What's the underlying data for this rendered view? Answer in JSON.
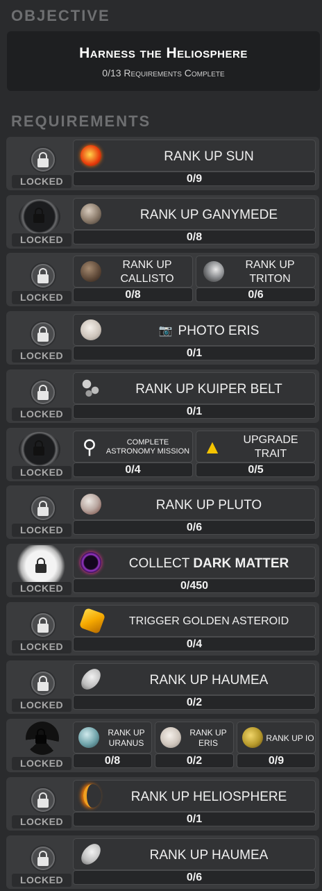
{
  "objective": {
    "section_title": "OBJECTIVE",
    "name": "Harness the Heliosphere",
    "progress": "0/13 Requirements Complete"
  },
  "requirements": {
    "section_title": "REQUIREMENTS",
    "locked_label": "LOCKED",
    "rows": [
      {
        "tasks": [
          {
            "label": "RANK UP SUN",
            "icon": "sun-icon",
            "progress": "0/9"
          }
        ]
      },
      {
        "tasks": [
          {
            "label": "RANK UP GANYMEDE",
            "icon": "ganymede-icon",
            "progress": "0/8"
          }
        ]
      },
      {
        "tasks": [
          {
            "label": "RANK UP CALLISTO",
            "icon": "callisto-icon",
            "progress": "0/8"
          },
          {
            "label": "RANK UP TRITON",
            "icon": "triton-icon",
            "progress": "0/6"
          }
        ]
      },
      {
        "tasks": [
          {
            "label": "PHOTO ERIS",
            "icon": "camera-icon",
            "progress": "0/1"
          }
        ]
      },
      {
        "tasks": [
          {
            "label": "RANK UP KUIPER BELT",
            "icon": "kuiper-belt-icon",
            "progress": "0/1"
          }
        ]
      },
      {
        "tasks": [
          {
            "label": "COMPLETE ASTRONOMY MISSION",
            "icon": "telescope-icon",
            "progress": "0/4"
          },
          {
            "label": "UPGRADE TRAIT",
            "icon": "trait-cards-icon",
            "progress": "0/5"
          }
        ]
      },
      {
        "tasks": [
          {
            "label": "RANK UP PLUTO",
            "icon": "pluto-icon",
            "progress": "0/6"
          }
        ]
      },
      {
        "tasks": [
          {
            "label_prefix": "COLLECT ",
            "label_strong": "DARK MATTER",
            "icon": "dark-matter-icon",
            "progress": "0/450"
          }
        ]
      },
      {
        "tasks": [
          {
            "label": "TRIGGER   GOLDEN ASTEROID",
            "icon": "golden-asteroid-icon",
            "progress": "0/4"
          }
        ]
      },
      {
        "tasks": [
          {
            "label": "RANK UP HAUMEA",
            "icon": "haumea-icon",
            "progress": "0/2"
          }
        ]
      },
      {
        "tasks": [
          {
            "label": "RANK UP URANUS",
            "icon": "uranus-icon",
            "progress": "0/8"
          },
          {
            "label": "RANK UP ERIS",
            "icon": "eris-icon",
            "progress": "0/2"
          },
          {
            "label": "RANK UP IO",
            "icon": "io-icon",
            "progress": "0/9"
          }
        ]
      },
      {
        "tasks": [
          {
            "label": "RANK UP HELIOSPHERE",
            "icon": "heliosphere-icon",
            "progress": "0/1"
          }
        ]
      },
      {
        "tasks": [
          {
            "label": "RANK UP HAUMEA",
            "icon": "haumea-icon",
            "progress": "0/6"
          }
        ]
      }
    ]
  }
}
